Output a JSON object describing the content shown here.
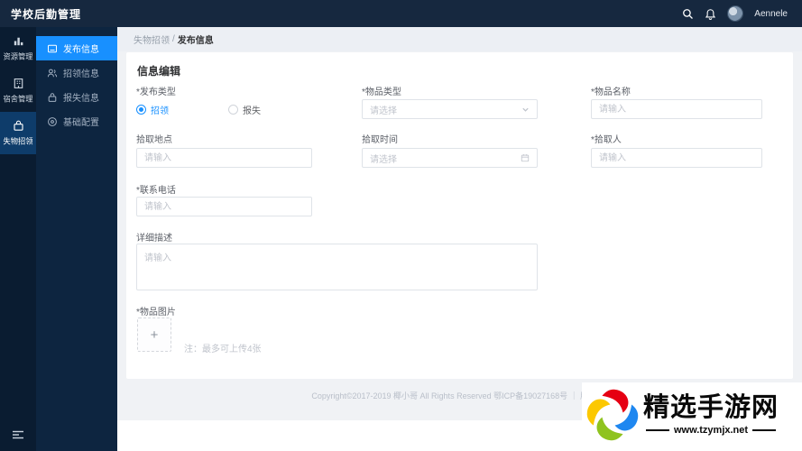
{
  "topbar": {
    "title": "学校后勤管理",
    "username": "Aennele"
  },
  "rail": {
    "items": [
      {
        "label": "资源管理",
        "icon": "bar-chart-icon",
        "active": false
      },
      {
        "label": "宿舍管理",
        "icon": "building-icon",
        "active": false
      },
      {
        "label": "失物招领",
        "icon": "bag-icon",
        "active": true
      }
    ]
  },
  "sidebar": {
    "items": [
      {
        "label": "发布信息",
        "icon": "publish-icon",
        "active": true
      },
      {
        "label": "招领信息",
        "icon": "users-icon",
        "active": false
      },
      {
        "label": "报失信息",
        "icon": "lock-icon",
        "active": false
      },
      {
        "label": "基础配置",
        "icon": "settings-icon",
        "active": false
      }
    ]
  },
  "breadcrumb": {
    "parent": "失物招领",
    "separator": "/",
    "current": "发布信息"
  },
  "form": {
    "title": "信息编辑",
    "publish_type": {
      "label": "*发布类型",
      "option_found": "招领",
      "option_lost": "报失",
      "selected": "招领"
    },
    "item_type": {
      "label": "*物品类型",
      "placeholder": "请选择"
    },
    "item_name": {
      "label": "*物品名称",
      "placeholder": "请输入"
    },
    "pickup_place": {
      "label": "拾取地点",
      "placeholder": "请输入"
    },
    "pickup_time": {
      "label": "拾取时间",
      "placeholder": "请选择"
    },
    "pickup_person": {
      "label": "*拾取人",
      "placeholder": "请输入"
    },
    "contact_phone": {
      "label": "*联系电话",
      "placeholder": "请输入"
    },
    "description": {
      "label": "详细描述",
      "placeholder": "请输入"
    },
    "item_images": {
      "label": "*物品图片",
      "plus": "+",
      "note": "注：最多可上传4张"
    }
  },
  "footer": {
    "copyright": "Copyright©2017-2019 椰小哥 All Rights Reserved 鄂ICP备19027168号 ｜ 版本1.0"
  },
  "watermark": {
    "title": "精选手游网",
    "url": "www.tzymjx.net"
  },
  "colors": {
    "accent": "#1890ff",
    "topbar": "#16283f",
    "rail": "#0a1c31",
    "submenu": "#0d2540",
    "page_bg": "#f0f2f5"
  }
}
